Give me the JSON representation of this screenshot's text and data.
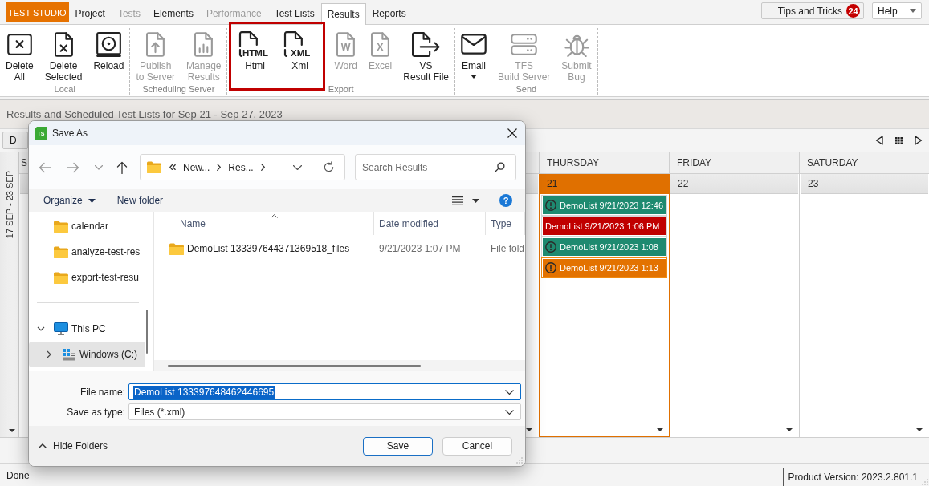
{
  "app": {
    "brand": "TEST STUDIO"
  },
  "tabs": [
    {
      "label": "Project",
      "selected": false,
      "disabled": false
    },
    {
      "label": "Tests",
      "selected": false,
      "disabled": true
    },
    {
      "label": "Elements",
      "selected": false,
      "disabled": false
    },
    {
      "label": "Performance",
      "selected": false,
      "disabled": true
    },
    {
      "label": "Test Lists",
      "selected": false,
      "disabled": false
    },
    {
      "label": "Results",
      "selected": true,
      "disabled": false
    },
    {
      "label": "Reports",
      "selected": false,
      "disabled": false
    }
  ],
  "tips_button": {
    "label": "Tips and Tricks",
    "badge": "24"
  },
  "help_menu": {
    "label": "Help"
  },
  "ribbon": {
    "groups": [
      {
        "label": "Local",
        "buttons": [
          {
            "kind": "deleteall",
            "label": "Delete\nAll",
            "disabled": false,
            "dropdown": false,
            "highlighted": false
          },
          {
            "kind": "deleteselected",
            "label": "Delete\nSelected",
            "disabled": false,
            "dropdown": false,
            "highlighted": false
          },
          {
            "kind": "reload",
            "label": "Reload",
            "disabled": false,
            "dropdown": false,
            "highlighted": false
          }
        ]
      },
      {
        "label": "Scheduling Server",
        "buttons": [
          {
            "kind": "publish",
            "label": "Publish\nto Server",
            "disabled": true,
            "dropdown": false,
            "highlighted": false
          },
          {
            "kind": "manage",
            "label": "Manage\nResults",
            "disabled": true,
            "dropdown": false,
            "highlighted": false
          }
        ]
      },
      {
        "label": "Export",
        "buttons": [
          {
            "kind": "html",
            "label": "Html",
            "icon_text": "HTML",
            "disabled": false,
            "dropdown": false,
            "highlighted": true
          },
          {
            "kind": "xml",
            "label": "Xml",
            "icon_text": "XML",
            "disabled": false,
            "dropdown": false,
            "highlighted": true
          },
          {
            "kind": "word",
            "label": "Word",
            "icon_text": "W",
            "disabled": true,
            "dropdown": false,
            "highlighted": false
          },
          {
            "kind": "excel",
            "label": "Excel",
            "icon_text": "X",
            "disabled": true,
            "dropdown": false,
            "highlighted": false
          },
          {
            "kind": "vsfile",
            "label": "VS\nResult File",
            "disabled": false,
            "dropdown": false,
            "highlighted": false
          }
        ]
      },
      {
        "label": "Send",
        "buttons": [
          {
            "kind": "email",
            "label": "Email",
            "disabled": false,
            "dropdown": true,
            "highlighted": false
          },
          {
            "kind": "tfs",
            "label": "TFS\nBuild Server",
            "disabled": true,
            "dropdown": false,
            "highlighted": false
          },
          {
            "kind": "bug",
            "label": "Submit\nBug",
            "disabled": true,
            "dropdown": false,
            "highlighted": false
          }
        ]
      }
    ]
  },
  "results_view": {
    "title": "Results and Scheduled Test Lists for Sep 21 - Sep 27, 2023",
    "toolbar_button": "D",
    "week_label": "17 SEP - 23 SEP",
    "days": [
      {
        "name": "S",
        "selected": false
      },
      {
        "name": "THURSDAY",
        "date": "21",
        "selected": true,
        "events": [
          {
            "label": "DemoList 9/21/2023 12:46",
            "color": "#1e8a70",
            "alert": true,
            "selected": false
          },
          {
            "label": "DemoList 9/21/2023 1:06 PM",
            "color": "#c00000",
            "alert": false,
            "selected": false
          },
          {
            "label": "DemoList 9/21/2023 1:08",
            "color": "#1e8a70",
            "alert": true,
            "selected": false
          },
          {
            "label": "DemoList 9/21/2023 1:13",
            "color": "#e37200",
            "alert": true,
            "selected": true
          }
        ]
      },
      {
        "name": "FRIDAY",
        "date": "22",
        "selected": false
      },
      {
        "name": "SATURDAY",
        "date": "23",
        "selected": false
      }
    ]
  },
  "save_dialog": {
    "title": "Save As",
    "app_icon_text": "TS",
    "address": [
      "New...",
      "Res..."
    ],
    "search": {
      "placeholder": "Search Results"
    },
    "organize": "Organize",
    "new_folder": "New folder",
    "help_glyph": "?",
    "nav_items": [
      {
        "label": "calendar",
        "selected": false
      },
      {
        "label": "analyze-test-res",
        "selected": false
      },
      {
        "label": "export-test-resu",
        "selected": false
      }
    ],
    "nav_tree": [
      {
        "label": "This PC",
        "kind": "computer",
        "expanded": true,
        "selected": false,
        "children": [
          {
            "label": "Windows (C:)",
            "kind": "drive",
            "expanded": false,
            "selected": true
          }
        ]
      }
    ],
    "columns": [
      {
        "label": "Name",
        "sorted": true
      },
      {
        "label": "Date modified",
        "sorted": false
      },
      {
        "label": "Type",
        "sorted": false
      }
    ],
    "files": [
      {
        "name": "DemoList 133397644371369518_files",
        "date_modified": "9/21/2023 1:07 PM",
        "type": "File fold"
      }
    ],
    "file_name": {
      "label": "File name:",
      "value": "DemoList 133397648462446695",
      "text_selected": true
    },
    "save_as_type": {
      "label": "Save as type:",
      "value": "Files (*.xml)"
    },
    "hide_folders": "Hide Folders",
    "buttons": [
      {
        "label": "Save",
        "default": true
      },
      {
        "label": "Cancel",
        "default": false
      }
    ]
  },
  "status": {
    "text": "Done",
    "version": "Product Version: 2023.2.801.1"
  }
}
